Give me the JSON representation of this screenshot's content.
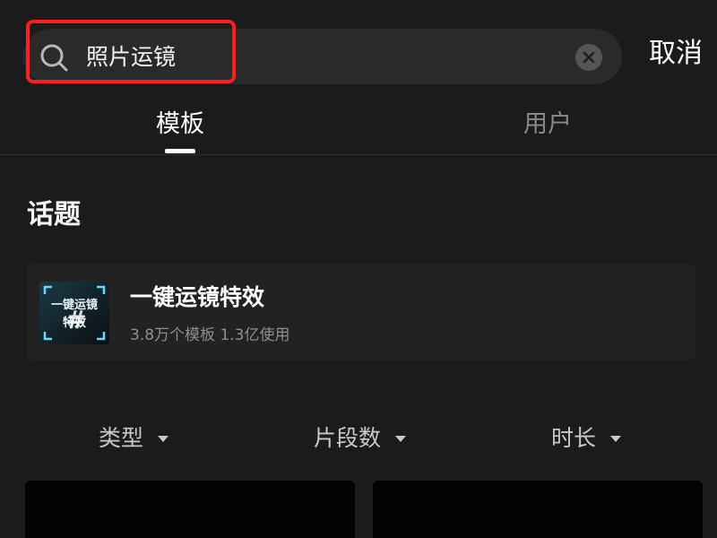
{
  "search": {
    "value": "照片运镜",
    "cancel_label": "取消"
  },
  "tabs": [
    {
      "label": "模板",
      "active": true
    },
    {
      "label": "用户",
      "active": false
    }
  ],
  "topics": {
    "section_title": "话题",
    "items": [
      {
        "title": "一键运镜特效",
        "meta": "3.8万个模板 1.3亿使用",
        "thumbnail_text": "一键运镜特效"
      }
    ]
  },
  "filters": [
    {
      "label": "类型"
    },
    {
      "label": "片段数"
    },
    {
      "label": "时长"
    }
  ],
  "colors": {
    "background": "#1b1b1b",
    "search_bg": "#2a2a2a",
    "annotation": "#ff1f1f",
    "active_tab": "#ffffff",
    "inactive_tab": "#8a8a8a",
    "thumb_accent": "#66d9ff"
  }
}
